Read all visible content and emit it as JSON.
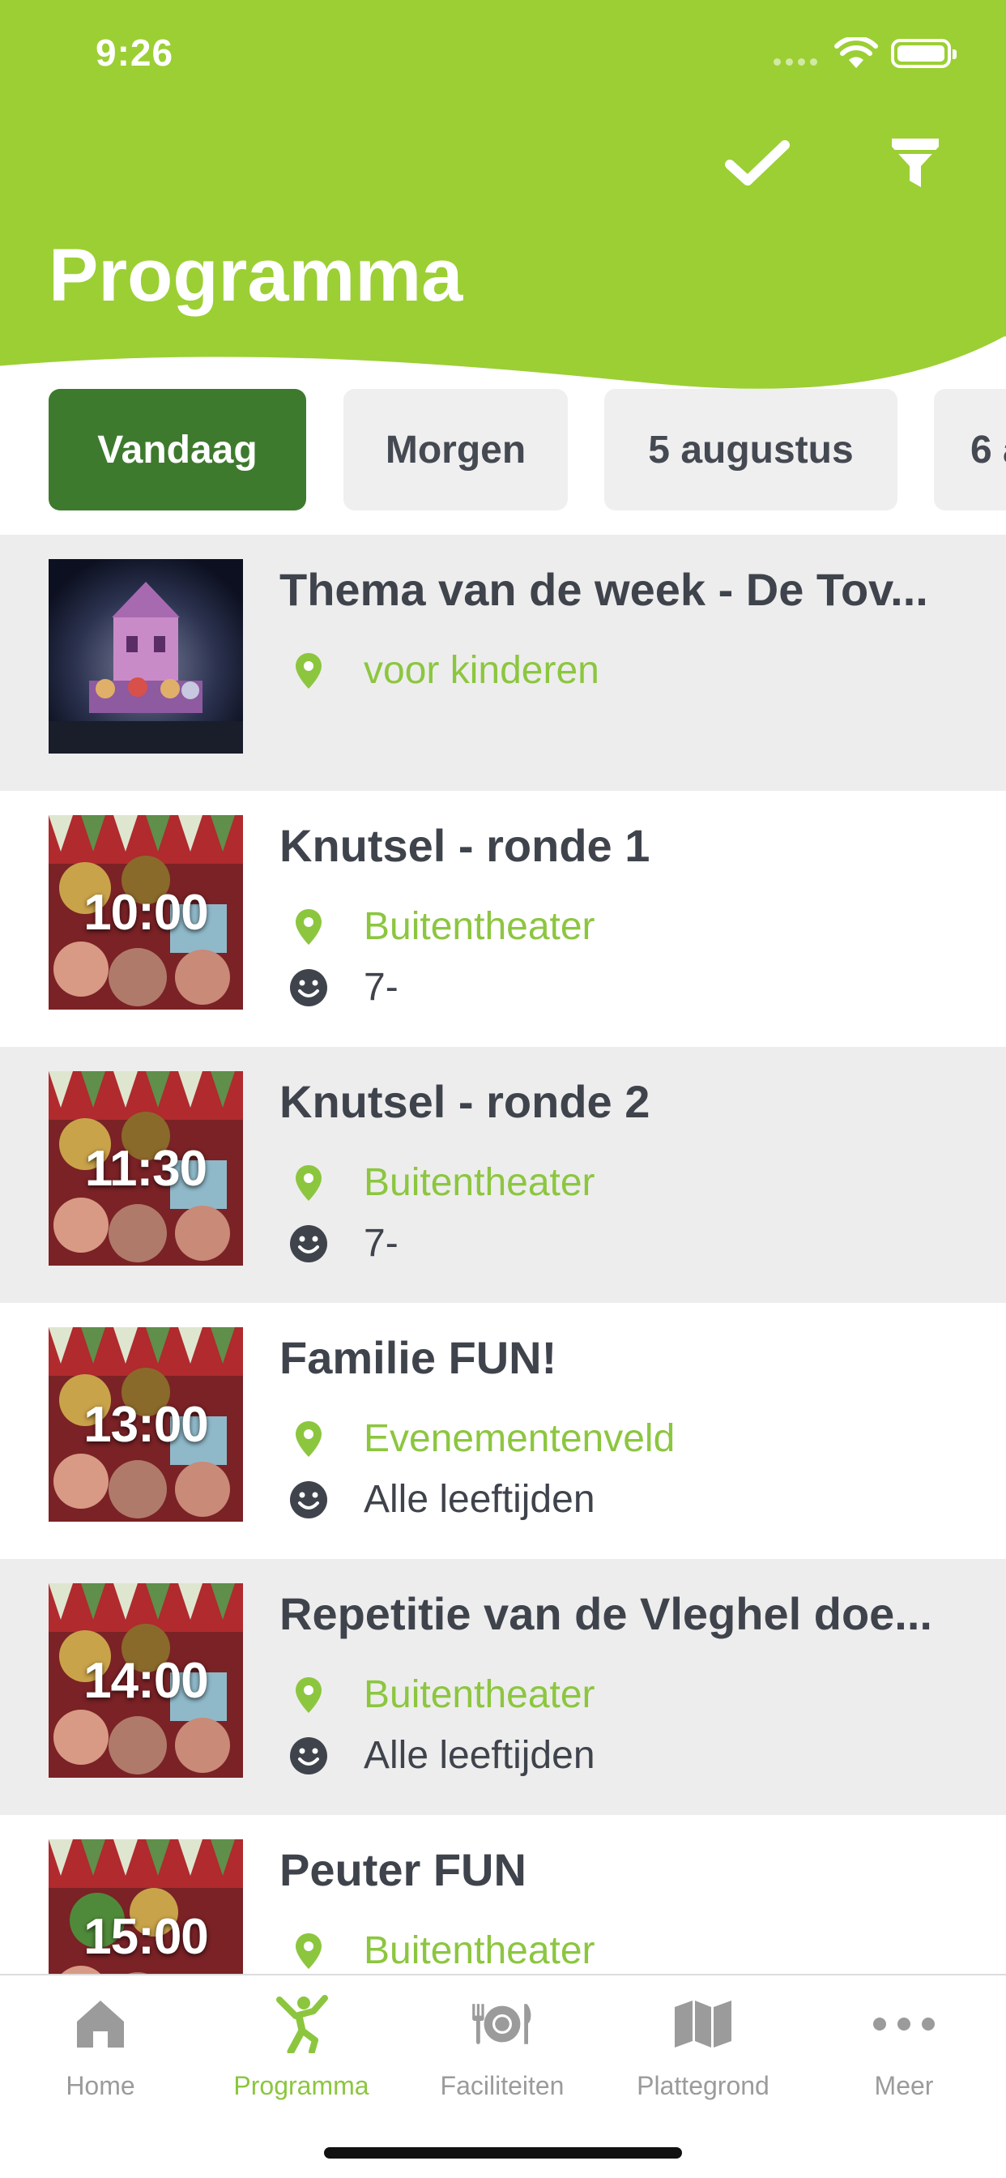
{
  "status_bar": {
    "time": "9:26"
  },
  "header": {
    "title": "Programma",
    "accent_color": "#9bcf34"
  },
  "icons": {
    "confirm": "checkmark-icon",
    "filter": "funnel-icon",
    "location": "map-pin-icon",
    "age": "smiley-icon"
  },
  "date_tabs": [
    {
      "label": "Vandaag",
      "active": true
    },
    {
      "label": "Morgen",
      "active": false
    },
    {
      "label": "5 augustus",
      "active": false
    },
    {
      "label": "6 a",
      "active": false
    }
  ],
  "events": [
    {
      "title": "Thema van de week - De Tov...",
      "time": "",
      "location": "voor kinderen",
      "age": ""
    },
    {
      "title": "Knutsel - ronde 1",
      "time": "10:00",
      "location": "Buitentheater",
      "age": "7-"
    },
    {
      "title": "Knutsel - ronde 2",
      "time": "11:30",
      "location": "Buitentheater",
      "age": "7-"
    },
    {
      "title": "Familie FUN!",
      "time": "13:00",
      "location": "Evenementenveld",
      "age": "Alle leeftijden"
    },
    {
      "title": "Repetitie van de Vleghel doe...",
      "time": "14:00",
      "location": "Buitentheater",
      "age": "Alle leeftijden"
    },
    {
      "title": "Peuter FUN",
      "time": "15:00",
      "location": "Buitentheater",
      "age": ""
    }
  ],
  "bottom_nav": [
    {
      "label": "Home",
      "icon": "house-icon",
      "active": false
    },
    {
      "label": "Programma",
      "icon": "dancer-icon",
      "active": true
    },
    {
      "label": "Faciliteiten",
      "icon": "plate-cutlery-icon",
      "active": false
    },
    {
      "label": "Plattegrond",
      "icon": "map-icon",
      "active": false
    },
    {
      "label": "Meer",
      "icon": "more-dots-icon",
      "active": false
    }
  ],
  "colors": {
    "green": "#9bcf34",
    "active_tab": "#3e7a2e",
    "location_text": "#8cc63f",
    "row_shade": "#ededed"
  }
}
